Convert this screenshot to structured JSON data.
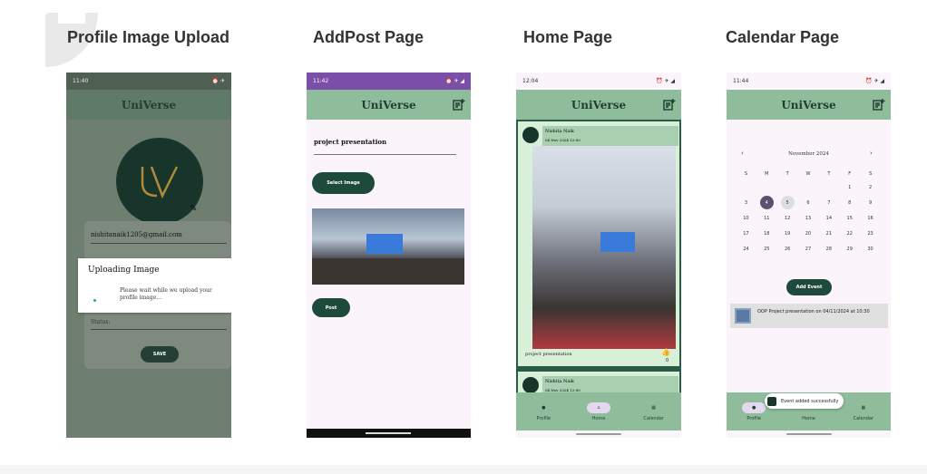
{
  "sections": {
    "profile": "Profile Image Upload",
    "addpost": "AddPost Page",
    "home": "Home Page",
    "calendar": "Calendar Page"
  },
  "colors": {
    "appbar": "#8fbc9a",
    "accent": "#1e4a3c",
    "bg": "#fbf4fb"
  },
  "brand": "UniVerse",
  "profile_screen": {
    "time": "11:40",
    "email": "nishitanaik1205@gmail.com",
    "status_label": "Status:",
    "save_label": "SAVE",
    "dialog_title": "Uploading Image",
    "dialog_message": "Please wait while we upload your profile image..."
  },
  "addpost_screen": {
    "time": "11:42",
    "input_value": "project presentation",
    "select_image_label": "Select Image",
    "post_label": "Post"
  },
  "home_screen": {
    "time": "12:04",
    "posts": [
      {
        "author": "Nishita Naik",
        "date": "04 Nov 2024 12:00",
        "caption": "project presentation",
        "likes": "0"
      },
      {
        "author": "Nishita Naik",
        "date": "04 Nov 2024 12:00"
      }
    ],
    "nav": [
      "Profile",
      "Home",
      "Calendar"
    ]
  },
  "calendar_screen": {
    "time": "11:44",
    "month": "November 2024",
    "weekdays": [
      "S",
      "M",
      "T",
      "W",
      "T",
      "F",
      "S"
    ],
    "days": [
      "",
      "",
      "",
      "",
      "",
      "1",
      "2",
      "3",
      "4",
      "5",
      "6",
      "7",
      "8",
      "9",
      "10",
      "11",
      "12",
      "13",
      "14",
      "15",
      "16",
      "17",
      "18",
      "19",
      "20",
      "21",
      "22",
      "23",
      "24",
      "25",
      "26",
      "27",
      "28",
      "29",
      "30"
    ],
    "selected_day": "4",
    "today_day": "5",
    "add_event_label": "Add Event",
    "event_text": "OOP Project presentation  on 04/11/2024 at 10:30",
    "toast": "Event added successfully",
    "nav": [
      "Profile",
      "Home",
      "Calendar"
    ]
  }
}
